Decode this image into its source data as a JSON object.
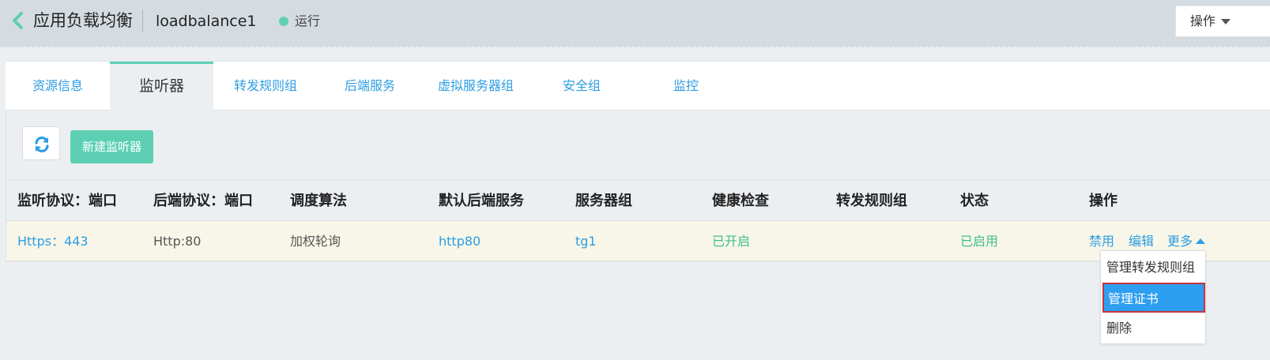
{
  "header": {
    "title": "应用负载均衡",
    "instance_name": "loadbalance1",
    "status": "运行",
    "status_color": "#62d0b4",
    "ops_label": "操作"
  },
  "tabs": [
    {
      "label": "资源信息",
      "active": false
    },
    {
      "label": "监听器",
      "active": true
    },
    {
      "label": "转发规则组",
      "active": false
    },
    {
      "label": "后端服务",
      "active": false
    },
    {
      "label": "虚拟服务器组",
      "active": false
    },
    {
      "label": "安全组",
      "active": false
    },
    {
      "label": "监控",
      "active": false
    }
  ],
  "toolbar": {
    "refresh_icon": "refresh-icon",
    "new_listener_label": "新建监听器"
  },
  "table": {
    "columns": [
      "监听协议：端口",
      "后端协议：端口",
      "调度算法",
      "默认后端服务",
      "服务器组",
      "健康检查",
      "转发规则组",
      "状态",
      "操作"
    ],
    "rows": [
      {
        "listen": "Https：443",
        "backend": "Http:80",
        "algorithm": "加权轮询",
        "default_backend": "http80",
        "server_group": "tg1",
        "health_check": "已开启",
        "rule_group": "",
        "status": "已启用",
        "actions": {
          "disable": "禁用",
          "edit": "编辑",
          "more": "更多"
        }
      }
    ]
  },
  "dropdown": {
    "items": [
      "管理转发规则组",
      "管理证书",
      "删除"
    ],
    "selected_index": 1
  },
  "colors": {
    "accent": "#5dd0b4",
    "link": "#2d9de2",
    "success": "#3fbf8f",
    "selected": "#2e9ef0"
  }
}
